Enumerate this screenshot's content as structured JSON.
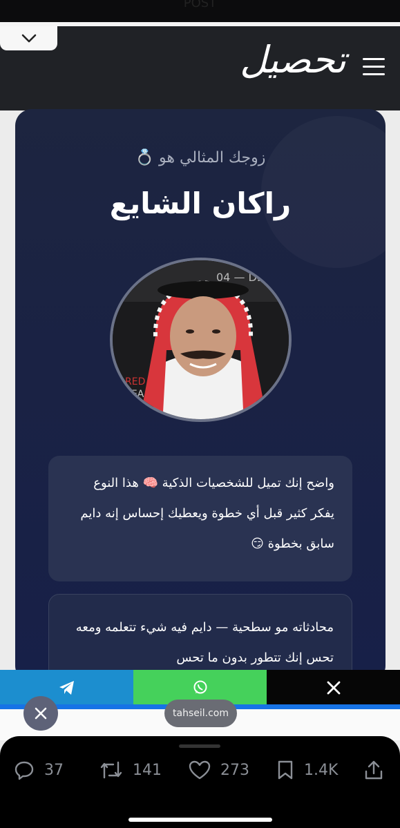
{
  "app": {
    "top_strip_text": "POST"
  },
  "header": {
    "brand": "تحصيل",
    "menu_icon": "hamburger-icon",
    "collapse_icon": "chevron-down-icon"
  },
  "card": {
    "subtitle": "زوجك المثالي هو 💍",
    "name": "راكان الشايع",
    "text_1": "واضح إنك تميل للشخصيات الذكية 🧠 هذا النوع يفكر كثير قبل أي خطوة ويعطيك إحساس إنه دايم سابق بخطوة 😏",
    "text_2": "محادثاته مو سطحية — دايم فيه شيء تتعلمه ومعه تحس إنك تتطور بدون ما تحس"
  },
  "share": {
    "telegram_icon": "telegram-icon",
    "whatsapp_icon": "whatsapp-icon",
    "x_icon": "x-icon",
    "colors": {
      "telegram": "#1c8ecf",
      "whatsapp": "#45d15b",
      "x": "#060606",
      "accent": "#1673e6"
    }
  },
  "overlay": {
    "domain": "tahseil.com",
    "close_icon": "close-icon"
  },
  "post_actions": {
    "replies": "37",
    "reposts": "141",
    "likes": "273",
    "bookmarks": "1.4K"
  }
}
